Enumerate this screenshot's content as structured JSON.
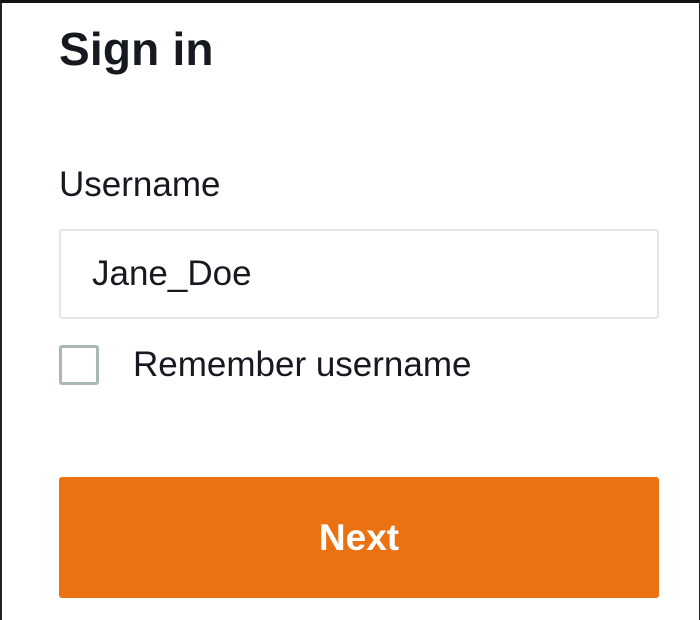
{
  "signin": {
    "title": "Sign in",
    "username_label": "Username",
    "username_value": "Jane_Doe",
    "remember_label": "Remember username",
    "remember_checked": false,
    "next_label": "Next"
  },
  "colors": {
    "primary_button": "#ec7211",
    "primary_button_text": "#ffffff",
    "text": "#16191f",
    "input_border": "#e4e7ea",
    "checkbox_border": "#aab7b8"
  }
}
